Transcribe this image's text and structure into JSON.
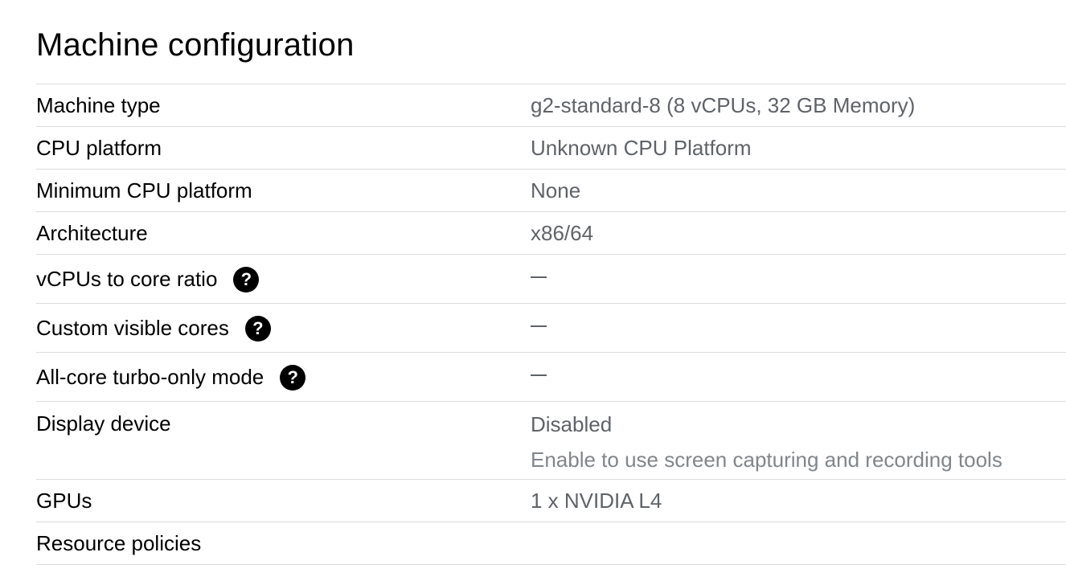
{
  "section": {
    "title": "Machine configuration"
  },
  "rows": [
    {
      "label": "Machine type",
      "value": "g2-standard-8 (8 vCPUs, 32 GB Memory)"
    },
    {
      "label": "CPU platform",
      "value": "Unknown CPU Platform"
    },
    {
      "label": "Minimum CPU platform",
      "value": "None"
    },
    {
      "label": "Architecture",
      "value": "x86/64"
    },
    {
      "label": "vCPUs to core ratio",
      "value": "—",
      "has_help": true
    },
    {
      "label": "Custom visible cores",
      "value": "—",
      "has_help": true
    },
    {
      "label": "All-core turbo-only mode",
      "value": "—",
      "has_help": true
    },
    {
      "label": "Display device",
      "value": "Disabled",
      "hint": "Enable to use screen capturing and recording tools"
    },
    {
      "label": "GPUs",
      "value": "1 x NVIDIA L4"
    },
    {
      "label": "Resource policies",
      "value": ""
    }
  ],
  "icons": {
    "help": "help-circle-icon",
    "help_glyph": "?"
  },
  "colors": {
    "label": "#000000",
    "value": "#5f6368",
    "hint": "#80868b",
    "divider": "#dadce0"
  }
}
